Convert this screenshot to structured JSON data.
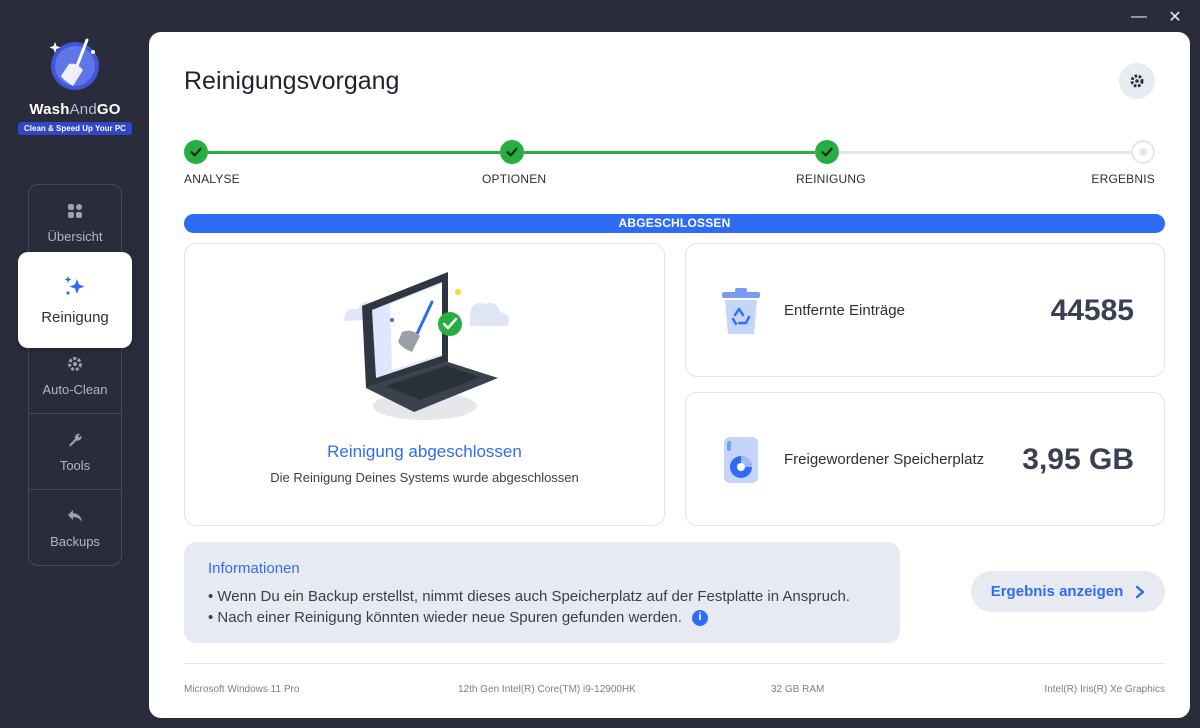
{
  "window": {
    "minimize_label": "—",
    "close_label": "✕"
  },
  "brand": {
    "name_part1": "Wash",
    "name_part2": "And",
    "name_part3": "GO",
    "tagline": "Clean & Speed Up Your PC"
  },
  "nav": {
    "items": [
      {
        "label": "Übersicht",
        "icon": "overview-icon"
      },
      {
        "label": "Reinigung",
        "icon": "sparkle-icon",
        "active": true
      },
      {
        "label": "Auto-Clean",
        "icon": "gear-icon"
      },
      {
        "label": "Tools",
        "icon": "wrench-icon"
      },
      {
        "label": "Backups",
        "icon": "undo-icon"
      }
    ]
  },
  "page": {
    "title": "Reinigungsvorgang"
  },
  "steps": [
    {
      "label": "ANALYSE",
      "done": true
    },
    {
      "label": "OPTIONEN",
      "done": true
    },
    {
      "label": "REINIGUNG",
      "done": true
    },
    {
      "label": "ERGEBNIS",
      "done": false
    }
  ],
  "progress": {
    "label": "ABGESCHLOSSEN",
    "value": 1.0
  },
  "completion": {
    "title": "Reinigung abgeschlossen",
    "subtitle": "Die Reinigung Deines Systems wurde abgeschlossen"
  },
  "stats": [
    {
      "label": "Entfernte Einträge",
      "value": "44585",
      "icon": "recycle-bin-icon"
    },
    {
      "label": "Freigewordener Speicherplatz",
      "value": "3,95 GB",
      "icon": "disk-icon"
    }
  ],
  "info": {
    "title": "Informationen",
    "lines": [
      "• Wenn Du ein Backup erstellst, nimmt dieses auch Speicherplatz auf der Festplatte in Anspruch.",
      "• Nach einer Reinigung könnten wieder neue Spuren gefunden werden."
    ]
  },
  "result_button": {
    "label": "Ergebnis anzeigen"
  },
  "system": {
    "os": "Microsoft Windows 11 Pro",
    "cpu": "12th Gen Intel(R) Core(TM) i9-12900HK",
    "ram": "32 GB RAM",
    "gpu": "Intel(R) Iris(R) Xe Graphics"
  },
  "colors": {
    "accent": "#2f6cf5",
    "success": "#27ae43",
    "sidebar_bg": "#2a2c3b"
  }
}
